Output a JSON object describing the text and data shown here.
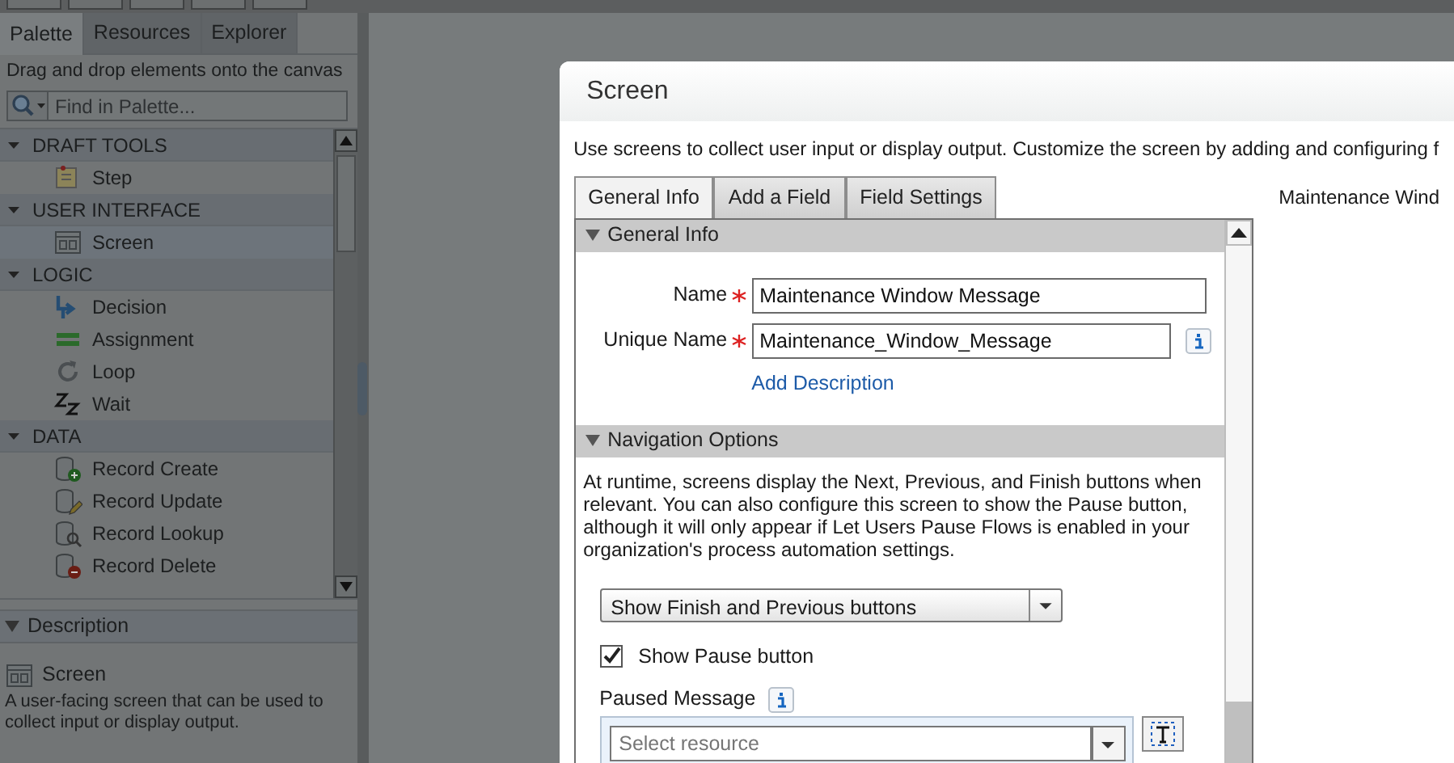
{
  "palette": {
    "tabs": [
      {
        "label": "Palette",
        "selected": true
      },
      {
        "label": "Resources",
        "selected": false
      },
      {
        "label": "Explorer",
        "selected": false
      }
    ],
    "hint": "Drag and drop elements onto the canvas",
    "search": {
      "placeholder": "Find in Palette..."
    },
    "sections": [
      {
        "title": "DRAFT TOOLS",
        "expanded": true,
        "items": [
          {
            "label": "Step",
            "kind": "step",
            "selected": false
          }
        ]
      },
      {
        "title": "USER INTERFACE",
        "expanded": true,
        "items": [
          {
            "label": "Screen",
            "kind": "screen",
            "selected": true
          }
        ]
      },
      {
        "title": "LOGIC",
        "expanded": true,
        "items": [
          {
            "label": "Decision",
            "kind": "decision",
            "selected": false
          },
          {
            "label": "Assignment",
            "kind": "assignment",
            "selected": false
          },
          {
            "label": "Loop",
            "kind": "loop",
            "selected": false
          },
          {
            "label": "Wait",
            "kind": "wait",
            "selected": false
          }
        ]
      },
      {
        "title": "DATA",
        "expanded": true,
        "items": [
          {
            "label": "Record Create",
            "kind": "create",
            "selected": false
          },
          {
            "label": "Record Update",
            "kind": "update",
            "selected": false
          },
          {
            "label": "Record Lookup",
            "kind": "lookup",
            "selected": false
          },
          {
            "label": "Record Delete",
            "kind": "delete",
            "selected": false
          }
        ]
      }
    ],
    "description": {
      "title": "Description",
      "expanded": true,
      "heading": "Screen",
      "text": "A user-facing screen that can be used to collect input or display output."
    }
  },
  "dialog": {
    "title": "Screen",
    "intro": "Use screens to collect user input or display output. Customize the screen by adding and configuring f",
    "tabs": [
      {
        "label": "General Info",
        "selected": true
      },
      {
        "label": "Add a Field",
        "selected": false
      },
      {
        "label": "Field Settings",
        "selected": false
      }
    ],
    "general_info": {
      "title": "General Info",
      "expanded": true,
      "fields": [
        {
          "label": "Name",
          "required": true,
          "value": "Maintenance Window Message",
          "info": false
        },
        {
          "label": "Unique Name",
          "required": true,
          "value": "Maintenance_Window_Message",
          "info": true
        }
      ],
      "link": "Add Description"
    },
    "navigation": {
      "title": "Navigation Options",
      "expanded": true,
      "text": "At runtime, screens display the Next, Previous, and Finish buttons when relevant. You can also configure this screen to show the Pause button, although it will only appear if Let Users Pause Flows is enabled in your organization's process automation settings.",
      "dropdown": "Show Finish and Previous buttons",
      "checkbox": {
        "label": "Show Pause button",
        "checked": true
      },
      "paused_message": {
        "label": "Paused Message",
        "placeholder": "Select resource"
      }
    },
    "preview_title": "Maintenance Wind"
  }
}
